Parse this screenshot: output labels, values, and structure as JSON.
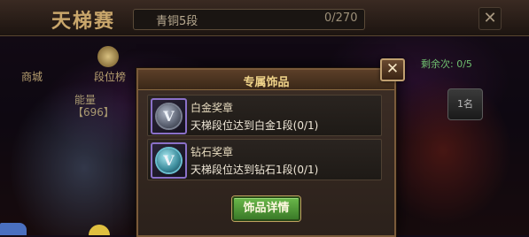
{
  "background": {
    "screen_title": "天梯赛",
    "rank_name": "青铜5段",
    "rank_progress": "0/270",
    "close_label": "✕",
    "shop_label": "商城",
    "ladder_label": "段位榜",
    "score_label": "能量",
    "score_value": "【696】",
    "remaining": "剩余次: 0/5",
    "rank_badge": "1名"
  },
  "dialog": {
    "title": "专属饰品",
    "close_label": "✕",
    "items": [
      {
        "name": "白金奖章",
        "condition": "天梯段位达到白金1段(0/1)",
        "icon": "platinum-medal-icon",
        "medal_letter": "V"
      },
      {
        "name": "钻石奖章",
        "condition": "天梯段位达到钻石1段(0/1)",
        "icon": "diamond-medal-icon",
        "medal_letter": "V"
      }
    ],
    "details_button": "饰品详情"
  },
  "colors": {
    "dialog_border": "#7a5a3a",
    "title_text": "#f0d48a",
    "button_green": "#4a9a38",
    "platinum_frame": "#8a70c8",
    "diamond_medal": "#3a8a9a"
  }
}
